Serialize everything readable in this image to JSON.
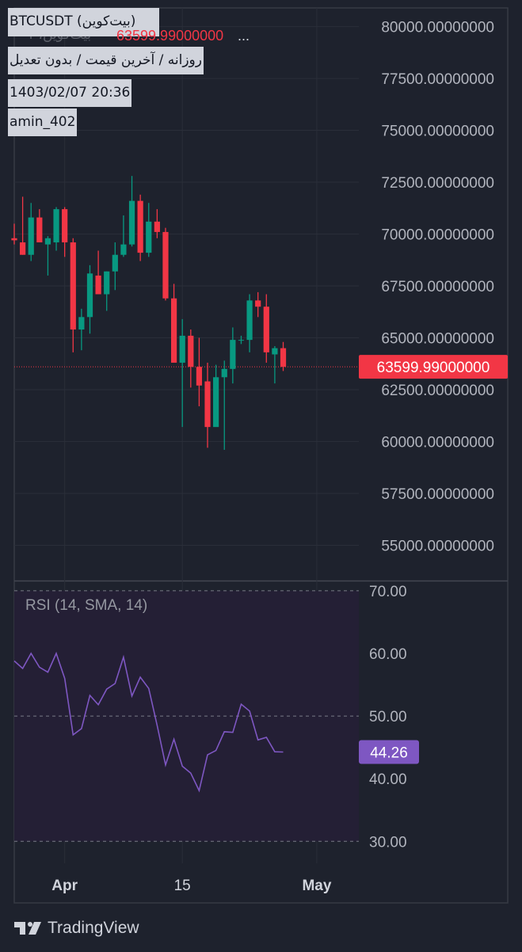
{
  "header": {
    "symbol": "BTCUSDT (بیت‌کوین)",
    "ghost_text": "بیت‌کوین، ۱",
    "price_fragment": "63599.99000000",
    "ellipsis": "...",
    "interval": "روزانه / آخرین قیمت / بدون تعدیل",
    "datetime": "1403/02/07 20:36",
    "author": "amin_402"
  },
  "price_label": "63599.99000000",
  "rsi": {
    "title": "RSI (14, SMA, 14)",
    "value_label": "44.26"
  },
  "brand": {
    "name": "TradingView",
    "icon": "tradingview-logo-icon"
  },
  "colors": {
    "background": "#1e222d",
    "up": "#089981",
    "down": "#f23645",
    "rsi_line": "#7e57c2",
    "rsi_band": "#241f35",
    "rsi_label": "#7e57c2",
    "axis_text": "#b2b5be",
    "grid": "#2a2e39"
  },
  "chart_data": [
    {
      "type": "candlestick",
      "title": "",
      "x_ticks": [
        {
          "day": 0,
          "label": "Apr"
        },
        {
          "day": 14,
          "label": "15"
        },
        {
          "day": 30,
          "label": "May"
        }
      ],
      "y_ticks": [
        "55000.00000000",
        "57500.00000000",
        "60000.00000000",
        "62500.00000000",
        "65000.00000000",
        "67500.00000000",
        "70000.00000000",
        "72500.00000000",
        "75000.00000000",
        "77500.00000000",
        "80000.00000000"
      ],
      "y_tick_values": [
        55000,
        57500,
        60000,
        62500,
        65000,
        67500,
        70000,
        72500,
        75000,
        77500,
        80000
      ],
      "ylim": [
        53300,
        80900
      ],
      "xlim": [
        -6,
        35
      ],
      "last_price": 63599.99,
      "candles": [
        {
          "day": -6,
          "o": 69800,
          "h": 70500,
          "l": 69500,
          "c": 69700
        },
        {
          "day": -5,
          "o": 69600,
          "h": 71800,
          "l": 69000,
          "c": 69000
        },
        {
          "day": -4,
          "o": 69000,
          "h": 71500,
          "l": 68700,
          "c": 70800
        },
        {
          "day": -3,
          "o": 70800,
          "h": 71200,
          "l": 69600,
          "c": 69600
        },
        {
          "day": -2,
          "o": 69500,
          "h": 69900,
          "l": 68000,
          "c": 69800
        },
        {
          "day": -1,
          "o": 69600,
          "h": 71300,
          "l": 69200,
          "c": 71200
        },
        {
          "day": 0,
          "o": 71200,
          "h": 71300,
          "l": 68900,
          "c": 69600
        },
        {
          "day": 1,
          "o": 69600,
          "h": 69800,
          "l": 64300,
          "c": 65400
        },
        {
          "day": 2,
          "o": 65400,
          "h": 66400,
          "l": 64400,
          "c": 66000
        },
        {
          "day": 3,
          "o": 66000,
          "h": 68500,
          "l": 65200,
          "c": 68100
        },
        {
          "day": 4,
          "o": 68000,
          "h": 69200,
          "l": 67400,
          "c": 67100
        },
        {
          "day": 5,
          "o": 67100,
          "h": 68200,
          "l": 66300,
          "c": 68200
        },
        {
          "day": 6,
          "o": 68200,
          "h": 69600,
          "l": 67300,
          "c": 69000
        },
        {
          "day": 7,
          "o": 69000,
          "h": 70900,
          "l": 68900,
          "c": 69500
        },
        {
          "day": 8,
          "o": 69500,
          "h": 72800,
          "l": 69400,
          "c": 71600
        },
        {
          "day": 9,
          "o": 71600,
          "h": 71900,
          "l": 68700,
          "c": 69100
        },
        {
          "day": 10,
          "o": 69100,
          "h": 71500,
          "l": 68900,
          "c": 70600
        },
        {
          "day": 11,
          "o": 70600,
          "h": 71200,
          "l": 69800,
          "c": 70100
        },
        {
          "day": 12,
          "o": 70100,
          "h": 70300,
          "l": 66800,
          "c": 66900
        },
        {
          "day": 13,
          "o": 66900,
          "h": 67600,
          "l": 64000,
          "c": 63800
        },
        {
          "day": 14,
          "o": 63800,
          "h": 65900,
          "l": 60700,
          "c": 65100
        },
        {
          "day": 15,
          "o": 65100,
          "h": 65400,
          "l": 62600,
          "c": 63600
        },
        {
          "day": 16,
          "o": 63600,
          "h": 65000,
          "l": 61700,
          "c": 62700
        },
        {
          "day": 17,
          "o": 62900,
          "h": 63800,
          "l": 59700,
          "c": 60700
        },
        {
          "day": 18,
          "o": 60700,
          "h": 63700,
          "l": 60900,
          "c": 63100
        },
        {
          "day": 19,
          "o": 63100,
          "h": 63900,
          "l": 59600,
          "c": 63500
        },
        {
          "day": 20,
          "o": 63500,
          "h": 65500,
          "l": 62800,
          "c": 64900
        },
        {
          "day": 21,
          "o": 64900,
          "h": 65100,
          "l": 64700,
          "c": 64900
        },
        {
          "day": 22,
          "o": 64900,
          "h": 67100,
          "l": 64300,
          "c": 66800
        },
        {
          "day": 23,
          "o": 66800,
          "h": 67200,
          "l": 66000,
          "c": 66500
        },
        {
          "day": 24,
          "o": 66500,
          "h": 67100,
          "l": 63800,
          "c": 64300
        },
        {
          "day": 25,
          "o": 64200,
          "h": 64600,
          "l": 62800,
          "c": 64500
        },
        {
          "day": 26,
          "o": 64500,
          "h": 64800,
          "l": 63400,
          "c": 63600
        }
      ]
    },
    {
      "type": "line",
      "title": "RSI (14, SMA, 14)",
      "ylim": [
        26.5,
        71.5
      ],
      "y_ticks": [
        "30.00",
        "40.00",
        "50.00",
        "60.00",
        "70.00"
      ],
      "y_tick_values": [
        30,
        40,
        50,
        60,
        70
      ],
      "band": [
        30,
        70
      ],
      "midline": 50,
      "last_value": 44.26,
      "series": [
        {
          "x": [
            -6,
            -5,
            -4,
            -3,
            -2,
            -1,
            0,
            1,
            2,
            3,
            4,
            5,
            6,
            7,
            8,
            9,
            10,
            11,
            12,
            13,
            14,
            15,
            16,
            17,
            18,
            19,
            20,
            21,
            22,
            23,
            24,
            25,
            26
          ],
          "values": [
            58.8,
            57.6,
            60.0,
            57.8,
            57.0,
            60.0,
            56.0,
            47.0,
            48.0,
            53.3,
            51.8,
            54.3,
            55.2,
            59.4,
            53.2,
            56.2,
            54.4,
            48.5,
            42.2,
            46.3,
            42.0,
            40.9,
            38.1,
            43.8,
            44.5,
            47.5,
            47.4,
            51.9,
            50.8,
            46.2,
            46.6,
            44.3,
            44.26
          ]
        }
      ]
    }
  ]
}
